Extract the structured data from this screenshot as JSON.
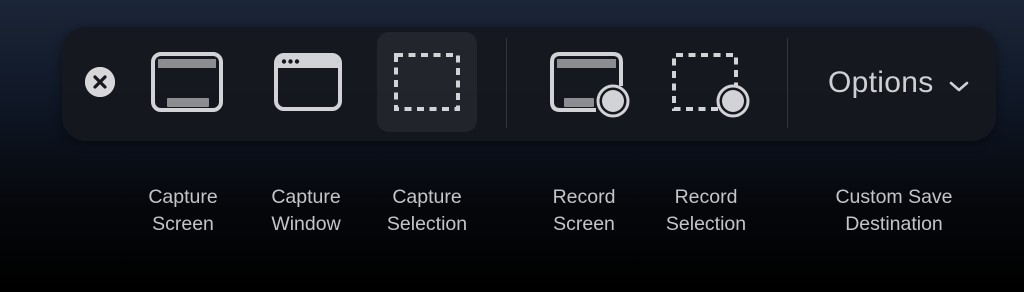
{
  "toolbar": {
    "close": {
      "icon": "close-circle-icon"
    },
    "buttons": [
      {
        "id": "capture-screen",
        "icon": "capture-screen-icon",
        "line1": "Capture",
        "line2": "Screen",
        "selected": false
      },
      {
        "id": "capture-window",
        "icon": "capture-window-icon",
        "line1": "Capture",
        "line2": "Window",
        "selected": false
      },
      {
        "id": "capture-selection",
        "icon": "capture-selection-icon",
        "line1": "Capture",
        "line2": "Selection",
        "selected": true
      },
      {
        "id": "record-screen",
        "icon": "record-screen-icon",
        "line1": "Record",
        "line2": "Screen",
        "selected": false
      },
      {
        "id": "record-selection",
        "icon": "record-selection-icon",
        "line1": "Record",
        "line2": "Selection",
        "selected": false
      }
    ],
    "options": {
      "label": "Options",
      "icon": "chevron-down-icon",
      "line1": "Custom Save",
      "line2": "Destination"
    }
  },
  "colors": {
    "icon": "#d2d3d6",
    "toolbar_bg": "#16181e",
    "label_text": "#c4c5c9"
  }
}
